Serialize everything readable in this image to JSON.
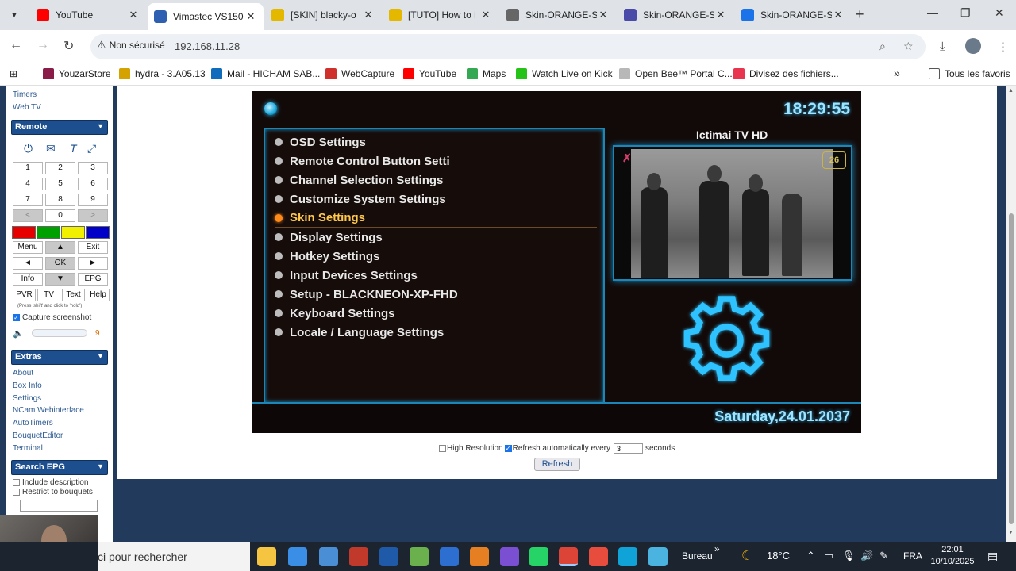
{
  "browser": {
    "tabs": [
      {
        "title": "YouTube",
        "favicon_color": "#ff0000",
        "active": false
      },
      {
        "title": "Vimastec VS150",
        "favicon_color": "#2f5fb0",
        "active": true
      },
      {
        "title": "[SKIN] blacky-o",
        "favicon_color": "#e5b800",
        "active": false
      },
      {
        "title": "[TUTO] How to i",
        "favicon_color": "#e5b800",
        "active": false
      },
      {
        "title": "Skin-ORANGE-S",
        "favicon_color": "#666666",
        "active": false
      },
      {
        "title": "Skin-ORANGE-S",
        "favicon_color": "#4a4aa8",
        "active": false
      },
      {
        "title": "Skin-ORANGE-S",
        "favicon_color": "#1a73e8",
        "active": false
      }
    ],
    "security_label": "Non sécurisé",
    "url": "192.168.11.28",
    "bookmarks": [
      {
        "label": "YouzarStore",
        "color": "#8a1c4a"
      },
      {
        "label": "hydra - 3.A05.13",
        "color": "#d4a300"
      },
      {
        "label": "Mail - HICHAM SAB...",
        "color": "#0f6cbd"
      },
      {
        "label": "WebCapture",
        "color": "#d0302b"
      },
      {
        "label": "YouTube",
        "color": "#ff0000"
      },
      {
        "label": "Maps",
        "color": "#34a853"
      },
      {
        "label": "Watch Live on Kick",
        "color": "#25c218"
      },
      {
        "label": "Open Bee™ Portal C...",
        "color": "#b8b8b8"
      },
      {
        "label": "Divisez des fichiers...",
        "color": "#e8344e"
      }
    ],
    "all_bookmarks_label": "Tous les favoris"
  },
  "left_panel": {
    "top_links": [
      "Timers",
      "Web TV"
    ],
    "remote_header": "Remote",
    "numpad": [
      "1",
      "2",
      "3",
      "4",
      "5",
      "6",
      "7",
      "8",
      "9",
      "<",
      "0",
      ">"
    ],
    "color_buttons": [
      "#e60000",
      "#00a000",
      "#f0f000",
      "#0000c8"
    ],
    "nav_buttons": [
      "Menu",
      "▲",
      "Exit",
      "◄",
      "OK",
      "►",
      "Info",
      "▼",
      "EPG"
    ],
    "mode_buttons": [
      "PVR",
      "TV",
      "Text",
      "Help"
    ],
    "hint": "(Press 'shift' and click to 'hold')",
    "capture_label": "Capture screenshot",
    "volume_value": "9",
    "extras_header": "Extras",
    "extras_links": [
      "About",
      "Box Info",
      "Settings",
      "NCam Webinterface",
      "AutoTimers",
      "BouquetEditor",
      "Terminal"
    ],
    "search_header": "Search EPG",
    "include_description": "Include description",
    "restrict_bouquets": "Restrict to bouquets"
  },
  "tv": {
    "clock": "18:29:55",
    "menu_items": [
      "OSD Settings",
      "Remote Control Button Setti",
      "Channel Selection Settings",
      "Customize System Settings",
      "Skin Settings",
      "Display Settings",
      "Hotkey Settings",
      "Input Devices Settings",
      "Setup - BLACKNEON-XP-FHD",
      "Keyboard Settings",
      "Locale / Language Settings"
    ],
    "selected_index": 4,
    "channel": "Ictimai TV HD",
    "channel_logo": "26",
    "date": "Saturday,24.01.2037"
  },
  "controls": {
    "high_resolution_label": "High Resolution",
    "refresh_auto_label": "Refresh automatically every",
    "refresh_seconds": "3",
    "seconds_label": "seconds",
    "refresh_button": "Refresh"
  },
  "taskbar": {
    "search_text": "ci pour rechercher",
    "desktop_label": "Bureau",
    "temperature": "18°C",
    "language": "FRA",
    "time": "22:01",
    "date": "10/10/2025"
  }
}
